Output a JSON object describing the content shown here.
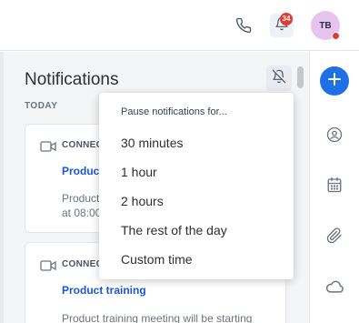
{
  "topbar": {
    "phone_icon": "phone-icon",
    "bell_icon": "bell-icon",
    "notification_count": "34",
    "avatar_initials": "TB"
  },
  "notifications": {
    "title": "Notifications",
    "section_today": "TODAY",
    "mute_icon": "bell-off-icon",
    "cards": [
      {
        "icon": "video-camera-icon",
        "kicker": "CONNEC",
        "title": "Product",
        "body_line1": "Product",
        "body_line2": "at 08:00"
      },
      {
        "icon": "video-camera-icon",
        "kicker": "CONNEC",
        "title": "Product training",
        "body_line1": "Product training meeting will be starting"
      }
    ]
  },
  "pause_menu": {
    "header": "Pause notifications for...",
    "options": [
      "30 minutes",
      "1 hour",
      "2 hours",
      "The rest of the day",
      "Custom time"
    ]
  },
  "rail": {
    "add_icon": "plus-icon",
    "icons": [
      "contact-icon",
      "calendar-icon",
      "paperclip-icon",
      "cloud-icon"
    ]
  },
  "colors": {
    "accent": "#1f6fe5",
    "link": "#1a56db",
    "badge": "#e53935",
    "avatar_bg": "#e6c4ef"
  }
}
